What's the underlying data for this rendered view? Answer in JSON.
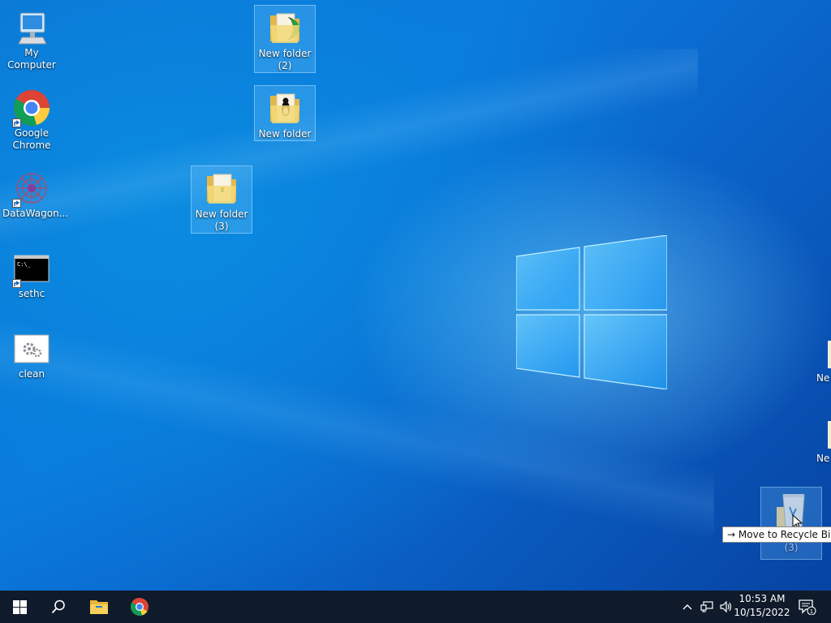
{
  "desktop": {
    "icons": [
      {
        "label": "My Computer"
      },
      {
        "label": "Google Chrome"
      },
      {
        "label": "DataWagon..."
      },
      {
        "label": "sethc"
      },
      {
        "label": "clean"
      },
      {
        "label": "New folder (2)"
      },
      {
        "label": "New folder"
      },
      {
        "label": "New folder (3)"
      },
      {
        "label": "New folder (3)"
      }
    ],
    "offscreen_labels": [
      "Ne",
      "Ne"
    ]
  },
  "drag_tooltip": {
    "arrow": "→",
    "text": "Move to Recycle Bin"
  },
  "taskbar": {
    "clock_time": "10:53 AM",
    "clock_date": "10/15/2022",
    "notification_count": "1",
    "icons": [
      "windows-start-icon",
      "search-icon",
      "file-explorer-icon",
      "chrome-icon"
    ],
    "tray_icons": [
      "chevron-up-icon",
      "network-icon",
      "volume-icon",
      "action-center-icon"
    ]
  },
  "colors": {
    "taskbar": "#0f1b2b",
    "desktop": "#0a78dc",
    "selection": "#78c8ff"
  }
}
